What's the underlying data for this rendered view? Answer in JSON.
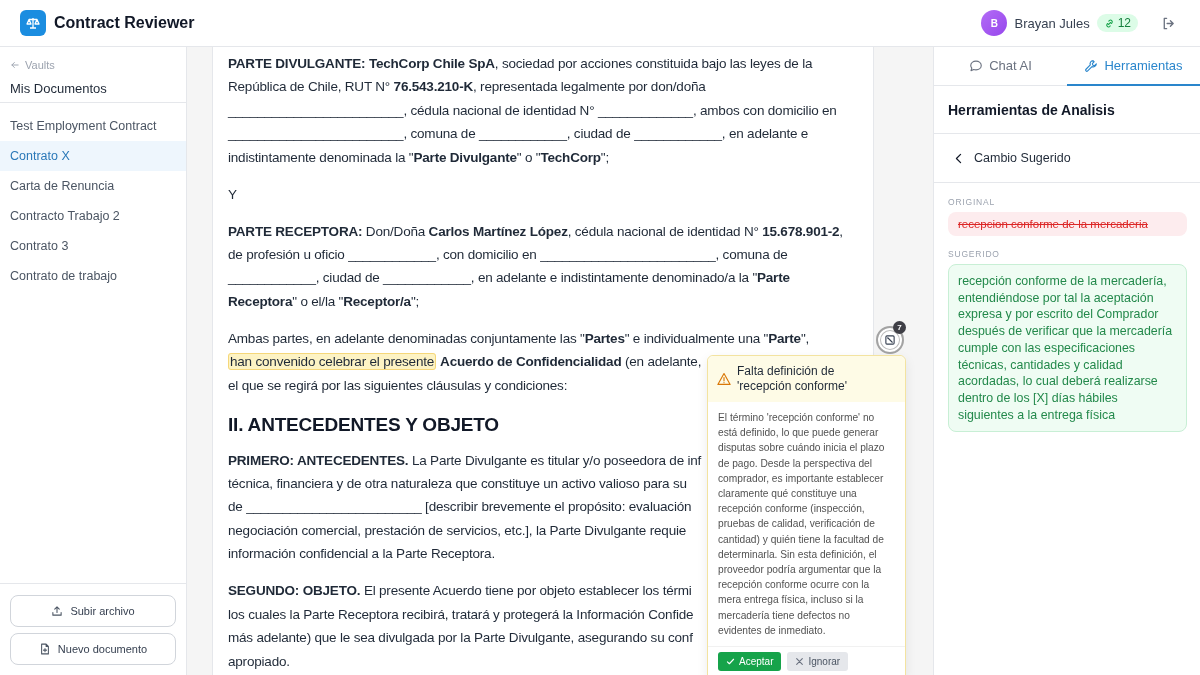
{
  "app": {
    "title": "Contract Reviewer"
  },
  "user": {
    "initial": "B",
    "name": "Brayan Jules",
    "credits": "12"
  },
  "sidebar": {
    "back_label": "Vaults",
    "vault_name": "Mis Documentos",
    "documents": [
      {
        "name": "Test Employment Contract",
        "selected": false
      },
      {
        "name": "Contrato X",
        "selected": true
      },
      {
        "name": "Carta de Renuncia",
        "selected": false
      },
      {
        "name": "Contracto Trabajo 2",
        "selected": false
      },
      {
        "name": "Contrato 3",
        "selected": false
      },
      {
        "name": "Contrato de trabajo",
        "selected": false
      }
    ],
    "buttons": [
      {
        "label": "Subir archivo",
        "kind": "upload"
      },
      {
        "label": "Nuevo documento",
        "kind": "new"
      }
    ]
  },
  "document": {
    "blocks": [
      {
        "kind": "paragraph",
        "lines": [
          "**PARTE DIVULGANTE: TechCorp Chile SpA**, sociedad por acciones constituida bajo las leyes de la",
          "República de Chile, RUT N° **76.543.210-K**, representada legalmente por don/doña",
          "________________________, cédula nacional de identidad N° _____________, ambos con domicilio en",
          "________________________, comuna de ____________, ciudad de ____________, en adelante e",
          "indistintamente denominada la \"**Parte Divulgante**\" o \"**TechCorp**\";"
        ]
      },
      {
        "kind": "paragraph",
        "lines": [
          "Y"
        ]
      },
      {
        "kind": "paragraph",
        "lines": [
          "**PARTE RECEPTORA:** Don/Doña **Carlos Martínez López**, cédula nacional de identidad N° **15.678.901-2**,",
          "de profesión u oficio ____________, con domicilio en ________________________, comuna de",
          "____________, ciudad de ____________, en adelante e indistintamente denominado/a la \"**Parte**",
          "**Receptora**\" o el/la \"**Receptor/a**\";"
        ]
      },
      {
        "kind": "paragraph",
        "lines": [
          "Ambas partes, en adelante denominadas conjuntamente las \"**Partes**\" e individualmente una \"**Parte**\",",
          {
            "highlight": "han convenido celebrar el presente",
            "text": "**Acuerdo de Confidencialidad** (en adelante,"
          },
          "el que se regirá por las siguientes cláusulas y condiciones:"
        ]
      },
      {
        "kind": "heading",
        "text": "II. ANTECEDENTES Y OBJETO"
      },
      {
        "kind": "paragraph",
        "lines": [
          "**PRIMERO: ANTECEDENTES.** La Parte Divulgante es titular y/o poseedora de inf",
          "técnica, financiera y de otra naturaleza que constituye un activo valioso para su",
          "de ________________________ [describir brevemente el propósito: evaluación",
          "negociación comercial, prestación de servicios, etc.], la Parte Divulgante requie",
          "información confidencial a la Parte Receptora."
        ]
      },
      {
        "kind": "paragraph",
        "lines": [
          "**SEGUNDO: OBJETO.** El presente Acuerdo tiene por objeto establecer los térmi",
          "los cuales la Parte Receptora recibirá, tratará y protegerá la Información Confide",
          "más adelante) que le sea divulgada por la Parte Divulgante, asegurando su conf",
          "apropiado."
        ]
      }
    ]
  },
  "issue_marker": {
    "count": "7"
  },
  "issue_popup": {
    "title": "Falta definición de 'recepción conforme'",
    "body": "El término 'recepción conforme' no está definido, lo que puede generar disputas sobre cuándo inicia el plazo de pago. Desde la perspectiva del comprador, es importante establecer claramente qué constituye una recepción conforme (inspección, pruebas de calidad, verificación de cantidad) y quién tiene la facultad de determinarla. Sin esta definición, el proveedor podría argumentar que la recepción conforme ocurre con la mera entrega física, incluso si la mercadería tiene defectos no evidentes de inmediato.",
    "actions": [
      {
        "label": "Aceptar",
        "kind": "accept"
      },
      {
        "label": "Ignorar",
        "kind": "ignore"
      }
    ]
  },
  "panel": {
    "tabs": [
      {
        "label": "Chat AI",
        "kind": "chat",
        "selected": false
      },
      {
        "label": "Herramientas",
        "kind": "tools",
        "selected": true
      }
    ],
    "title": "Herramientas de Analisis",
    "view_title": "Cambio Sugerido",
    "original_label": "ORIGINAL",
    "original_text": "recepcion conforme de la mercaderia",
    "suggested_label": "SUGERIDO",
    "suggested_text": "recepción conforme de la mercadería, entendiéndose por tal la aceptación expresa y por escrito del Comprador después de verificar que la mercadería cumple con las especificaciones técnicas, cantidades y calidad acordadas, lo cual deberá realizarse dentro de los [X] días hábiles siguientes a la entrega física"
  }
}
